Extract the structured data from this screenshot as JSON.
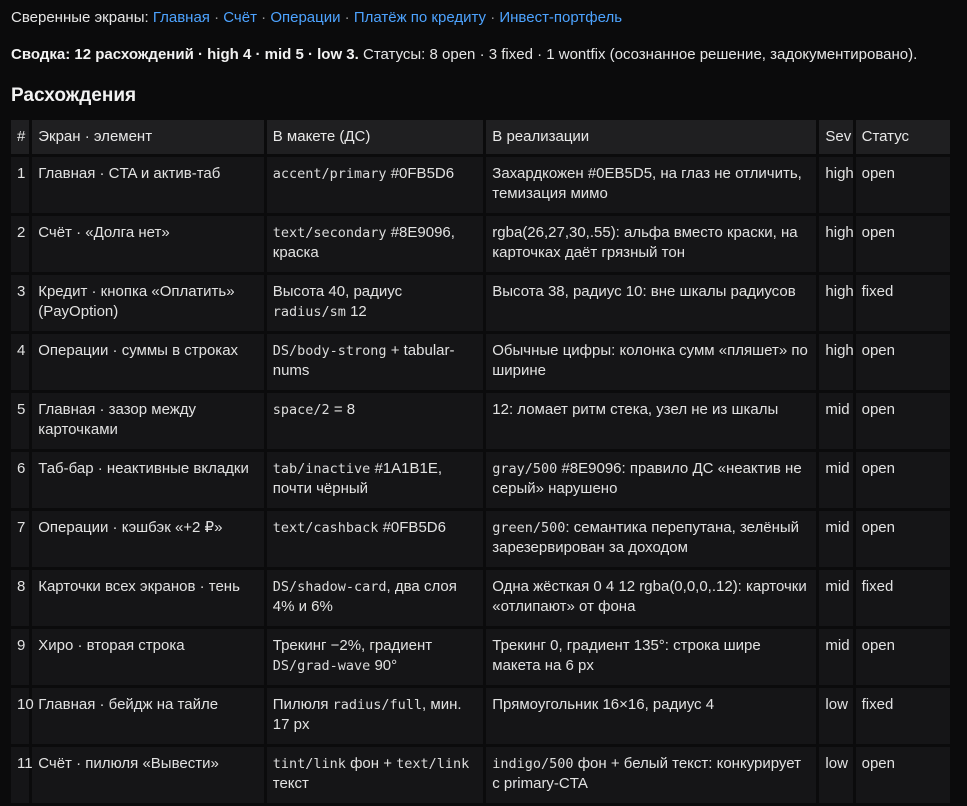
{
  "nav": {
    "prefix": "Сверенные экраны:",
    "links": [
      "Главная",
      "Счёт",
      "Операции",
      "Платёж по кредиту",
      "Инвест-портфель"
    ],
    "separator": "·"
  },
  "summary": {
    "lead": "Сводка: 12 расхождений · high 4 · mid 5 · low 3.",
    "rest": "Статусы: 8 open · 3 fixed · 1 wontfix (осознанное решение, задокументировано)."
  },
  "section_title": "Расхождения",
  "table": {
    "headers": [
      "#",
      "Экран · элемент",
      "В макете (ДС)",
      "В реализации",
      "Sev",
      "Статус"
    ],
    "rows": [
      {
        "n": "1",
        "screen": "Главная · CTA и актив-таб",
        "design": [
          {
            "code": "accent/primary"
          },
          {
            "t": " #0FB5D6"
          }
        ],
        "impl": [
          {
            "t": "Захардкожен #0EB5D5, на глаз не отличить, темизация мимо"
          }
        ],
        "sev": "high",
        "status": "open"
      },
      {
        "n": "2",
        "screen": "Счёт · «Долга нет»",
        "design": [
          {
            "code": "text/secondary"
          },
          {
            "t": " #8E9096, краска"
          }
        ],
        "impl": [
          {
            "t": "rgba(26,27,30,.55): альфа вместо краски, на карточках даёт грязный тон"
          }
        ],
        "sev": "high",
        "status": "open"
      },
      {
        "n": "3",
        "screen": "Кредит · кнопка «Оплатить» (PayOption)",
        "design": [
          {
            "t": "Высота 40, радиус "
          },
          {
            "code": "radius/sm"
          },
          {
            "t": " 12"
          }
        ],
        "impl": [
          {
            "t": "Высота 38, радиус 10: вне шкалы радиусов"
          }
        ],
        "sev": "high",
        "status": "fixed"
      },
      {
        "n": "4",
        "screen": "Операции · суммы в строках",
        "design": [
          {
            "code": "DS/body-strong"
          },
          {
            "t": " + tabular-nums"
          }
        ],
        "impl": [
          {
            "t": "Обычные цифры: колонка сумм «пляшет» по ширине"
          }
        ],
        "sev": "high",
        "status": "open"
      },
      {
        "n": "5",
        "screen": "Главная · зазор между карточками",
        "design": [
          {
            "code": "space/2"
          },
          {
            "t": " = 8"
          }
        ],
        "impl": [
          {
            "t": "12: ломает ритм стека, узел не из шкалы"
          }
        ],
        "sev": "mid",
        "status": "open"
      },
      {
        "n": "6",
        "screen": "Таб-бар · неактивные вкладки",
        "design": [
          {
            "code": "tab/inactive"
          },
          {
            "t": " #1A1B1E, почти чёрный"
          }
        ],
        "impl": [
          {
            "code": "gray/500"
          },
          {
            "t": " #8E9096: правило ДС «неактив не серый» нарушено"
          }
        ],
        "sev": "mid",
        "status": "open"
      },
      {
        "n": "7",
        "screen": "Операции · кэшбэк «+2 ₽»",
        "design": [
          {
            "code": "text/cashback"
          },
          {
            "t": " #0FB5D6"
          }
        ],
        "impl": [
          {
            "code": "green/500"
          },
          {
            "t": ": семантика перепутана, зелёный зарезервирован за доходом"
          }
        ],
        "sev": "mid",
        "status": "open"
      },
      {
        "n": "8",
        "screen": "Карточки всех экранов · тень",
        "design": [
          {
            "code": "DS/shadow-card"
          },
          {
            "t": ", два слоя 4% и 6%"
          }
        ],
        "impl": [
          {
            "t": "Одна жёсткая 0 4 12 rgba(0,0,0,.12): карточки «отлипают» от фона"
          }
        ],
        "sev": "mid",
        "status": "fixed"
      },
      {
        "n": "9",
        "screen": "Хиро · вторая строка",
        "design": [
          {
            "t": "Трекинг −2%, градиент "
          },
          {
            "code": "DS/grad-wave"
          },
          {
            "t": " 90°"
          }
        ],
        "impl": [
          {
            "t": "Трекинг 0, градиент 135°: строка шире макета на 6 px"
          }
        ],
        "sev": "mid",
        "status": "open"
      },
      {
        "n": "10",
        "screen": "Главная · бейдж на тайле",
        "design": [
          {
            "t": "Пилюля "
          },
          {
            "code": "radius/full"
          },
          {
            "t": ", мин. 17 px"
          }
        ],
        "impl": [
          {
            "t": "Прямоугольник 16×16, радиус 4"
          }
        ],
        "sev": "low",
        "status": "fixed"
      },
      {
        "n": "11",
        "screen": "Счёт · пилюля «Вывести»",
        "design": [
          {
            "code": "tint/link"
          },
          {
            "t": " фон + "
          },
          {
            "code": "text/link"
          },
          {
            "t": " текст"
          }
        ],
        "impl": [
          {
            "code": "indigo/500"
          },
          {
            "t": " фон + белый текст: конкурирует с primary-CTA"
          }
        ],
        "sev": "low",
        "status": "open"
      }
    ]
  }
}
